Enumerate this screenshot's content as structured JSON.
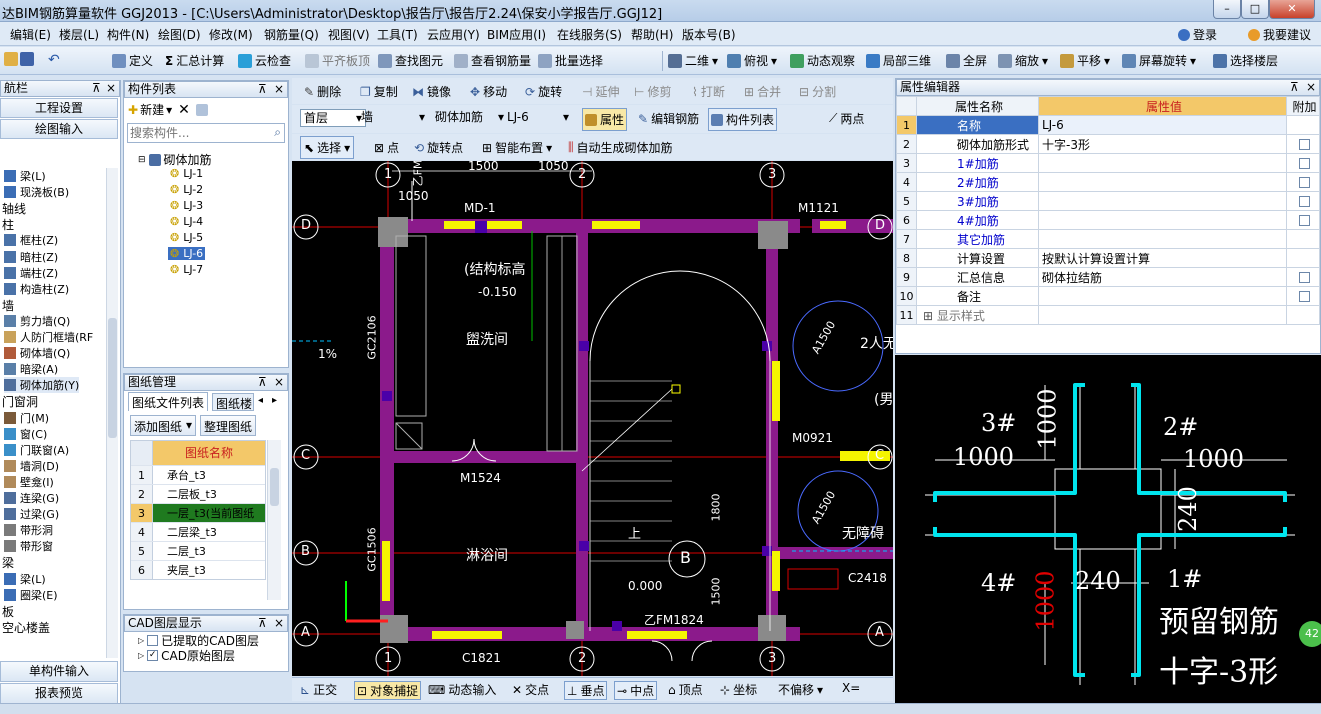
{
  "titlebar": {
    "title": "达BIM钢筋算量软件 GGJ2013 - [C:\\Users\\Administrator\\Desktop\\报告厅\\报告厅2.24\\保安小学报告厅.GGJ12]",
    "min": "–",
    "max": "□",
    "close": "✕"
  },
  "menu": [
    "编辑(E)",
    "楼层(L)",
    "构件(N)",
    "绘图(D)",
    "修改(M)",
    "钢筋量(Q)",
    "视图(V)",
    "工具(T)",
    "云应用(Y)",
    "BIM应用(I)",
    "在线服务(S)",
    "帮助(H)",
    "版本号(B)"
  ],
  "menu_right": {
    "login": "登录",
    "suggest": "我要建议"
  },
  "toolbar1": [
    "定义",
    "汇总计算",
    "云检查",
    "平齐板顶",
    "查找图元",
    "查看钢筋量",
    "批量选择",
    "二维",
    "俯视",
    "动态观察",
    "局部三维",
    "全屏",
    "缩放",
    "平移",
    "屏幕旋转",
    "选择楼层"
  ],
  "left": {
    "title": "航栏",
    "btn_settings": "工程设置",
    "btn_draw": "绘图输入",
    "items": [
      {
        "t": "梁(L)"
      },
      {
        "t": "现浇板(B)"
      },
      {
        "t": "轴线",
        "head": true
      },
      {
        "t": "柱",
        "head": true
      },
      {
        "t": "框柱(Z)"
      },
      {
        "t": "暗柱(Z)"
      },
      {
        "t": "端柱(Z)"
      },
      {
        "t": "构造柱(Z)"
      },
      {
        "t": "墙",
        "head": true
      },
      {
        "t": "剪力墙(Q)"
      },
      {
        "t": "人防门框墙(RF"
      },
      {
        "t": "砌体墙(Q)"
      },
      {
        "t": "暗梁(A)"
      },
      {
        "t": "砌体加筋(Y)"
      },
      {
        "t": "门窗洞",
        "head": true
      },
      {
        "t": "门(M)"
      },
      {
        "t": "窗(C)"
      },
      {
        "t": "门联窗(A)"
      },
      {
        "t": "墙洞(D)"
      },
      {
        "t": "壁龛(I)"
      },
      {
        "t": "连梁(G)"
      },
      {
        "t": "过梁(G)"
      },
      {
        "t": "带形洞"
      },
      {
        "t": "带形窗"
      },
      {
        "t": "梁",
        "head": true
      },
      {
        "t": "梁(L)"
      },
      {
        "t": "圈梁(E)"
      },
      {
        "t": "板",
        "head": true
      },
      {
        "t": "空心楼盖",
        "head": true
      }
    ],
    "btn_single": "单构件输入",
    "btn_report": "报表预览"
  },
  "complist": {
    "title": "构件列表",
    "new": "新建",
    "search_placeholder": "搜索构件...",
    "root": "砌体加筋",
    "items": [
      "LJ-1",
      "LJ-2",
      "LJ-3",
      "LJ-4",
      "LJ-5",
      "LJ-6",
      "LJ-7"
    ],
    "selected": "LJ-6"
  },
  "drawmgr": {
    "title": "图纸管理",
    "tab1": "图纸文件列表",
    "tab2": "图纸楼",
    "add": "添加图纸",
    "organize": "整理图纸",
    "col": "图纸名称",
    "rows": [
      {
        "n": "1",
        "name": "承台_t3"
      },
      {
        "n": "2",
        "name": "二层板_t3"
      },
      {
        "n": "3",
        "name": "一层_t3(当前图纸"
      },
      {
        "n": "4",
        "name": "二层梁_t3"
      },
      {
        "n": "5",
        "name": "二层_t3"
      },
      {
        "n": "6",
        "name": "夹层_t3"
      }
    ]
  },
  "cadlayer": {
    "title": "CAD图层显示",
    "l1": "已提取的CAD图层",
    "l2": "CAD原始图层"
  },
  "tb2": [
    "删除",
    "复制",
    "镜像",
    "移动",
    "旋转",
    "延伸",
    "修剪",
    "打断",
    "合并",
    "分割"
  ],
  "tb3": {
    "floor": "首层",
    "type": "墙",
    "sub": "砌体加筋",
    "comp": "LJ-6",
    "attr": "属性",
    "edit": "编辑钢筋",
    "list": "构件列表",
    "twopt": "两点"
  },
  "tb4": {
    "select": "选择",
    "point": "点",
    "rotpoint": "旋转点",
    "smart": "智能布置",
    "auto": "自动生成砌体加筋"
  },
  "status2": [
    "正交",
    "对象捕捉",
    "动态输入",
    "交点",
    "垂点",
    "中点",
    "顶点",
    "坐标",
    "不偏移",
    "X="
  ],
  "canvas_text": {
    "axis_1": "1",
    "axis_2": "2",
    "axis_3": "3",
    "axis_A": "A",
    "axis_B": "B",
    "axis_C": "C",
    "axis_D": "D",
    "dim_1500": "1500",
    "dim_1050": "1050",
    "dim_1050b": "1050",
    "md1": "MD-1",
    "m1121": "M1121",
    "m1524": "M1524",
    "m0921": "M0921",
    "struct_elev": "(结构标高",
    "elev": "-0.150",
    "wash": "盥洗间",
    "shower": "淋浴间",
    "gc2106": "GC2106",
    "gc1506": "GC1506",
    "pct": "1%",
    "up": "上",
    "b_big": "B",
    "zero": "0.000",
    "fm1824": "乙FM1824",
    "c1821": "C1821",
    "c2418": "C2418",
    "a1500": "A1500",
    "a1500b": "A1500",
    "d1800": "1800",
    "d1500": "1500",
    "two_people": "2人无",
    "male": "(男",
    "barrier": "无障碍",
    "fm": "乙FM"
  },
  "props": {
    "title": "属性编辑器",
    "col_name": "属性名称",
    "col_value": "属性值",
    "col_add": "附加",
    "rows": [
      {
        "n": "1",
        "name": "名称",
        "value": "LJ-6",
        "blue": true,
        "chk": false,
        "sel": true
      },
      {
        "n": "2",
        "name": "砌体加筋形式",
        "value": "十字-3形",
        "blue": false,
        "chk": true
      },
      {
        "n": "3",
        "name": "1#加筋",
        "value": "",
        "blue": true,
        "chk": true
      },
      {
        "n": "4",
        "name": "2#加筋",
        "value": "",
        "blue": true,
        "chk": true
      },
      {
        "n": "5",
        "name": "3#加筋",
        "value": "",
        "blue": true,
        "chk": true
      },
      {
        "n": "6",
        "name": "4#加筋",
        "value": "",
        "blue": true,
        "chk": true
      },
      {
        "n": "7",
        "name": "其它加筋",
        "value": "",
        "blue": true,
        "chk": false
      },
      {
        "n": "8",
        "name": "计算设置",
        "value": "按默认计算设置计算",
        "blue": false,
        "chk": false
      },
      {
        "n": "9",
        "name": "汇总信息",
        "value": "砌体拉结筋",
        "blue": false,
        "chk": true
      },
      {
        "n": "10",
        "name": "备注",
        "value": "",
        "blue": false,
        "chk": true
      },
      {
        "n": "11",
        "name": "显示样式",
        "value": "",
        "blue": false,
        "chk": false,
        "expand": "+"
      }
    ]
  },
  "preview": {
    "l3": "3#",
    "l2": "2#",
    "l4": "4#",
    "l1": "1#",
    "d1000a": "1000",
    "d1000b": "1000",
    "d1000c": "1000",
    "d1000d": "1000",
    "d240a": "240",
    "d240b": "240",
    "cap1": "预留钢筋",
    "cap2": "十字-3形",
    "badge": "42"
  },
  "colors": {
    "wall_magenta": "#8b1a8b",
    "door_yellow": "#f5f500",
    "axis_red": "#d80000",
    "rebar_cyan": "#00e5ee",
    "accent_blue": "#0000cc"
  }
}
